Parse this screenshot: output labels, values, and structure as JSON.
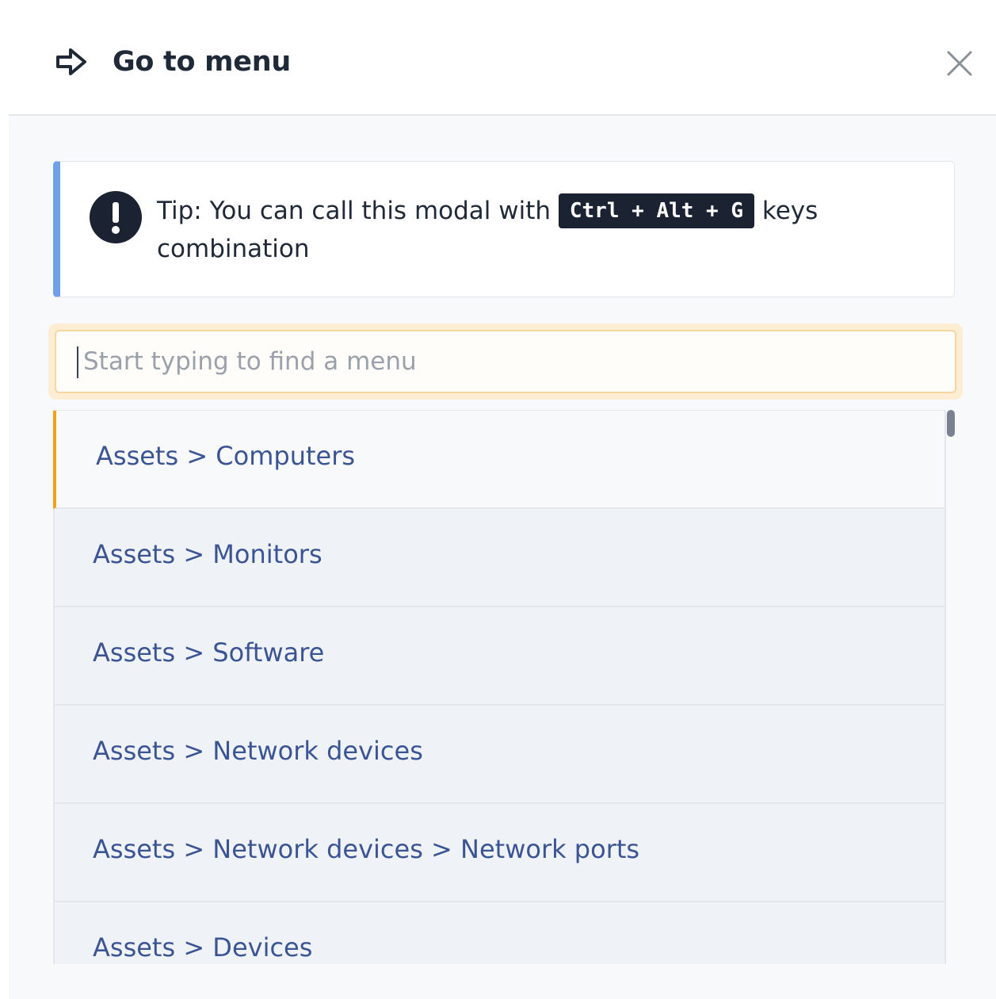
{
  "header": {
    "title": "Go to menu",
    "title_icon": "arrow-right-icon",
    "close_icon": "close-icon"
  },
  "tip": {
    "text_before": "Tip: You can call this modal with ",
    "shortcut": "Ctrl + Alt + G",
    "text_after": " keys combination",
    "icon": "exclamation-circle-icon",
    "accent_color": "#6fa0e8"
  },
  "search": {
    "placeholder": "Start typing to find a menu",
    "value": ""
  },
  "menu_items": [
    "Assets > Computers",
    "Assets > Monitors",
    "Assets > Software",
    "Assets > Network devices",
    "Assets > Network devices > Network ports",
    "Assets > Devices"
  ],
  "active_index": 0,
  "colors": {
    "active_marker": "#f0a21a",
    "item_text": "#3b5494",
    "focus_ring": "#fdeed3"
  }
}
